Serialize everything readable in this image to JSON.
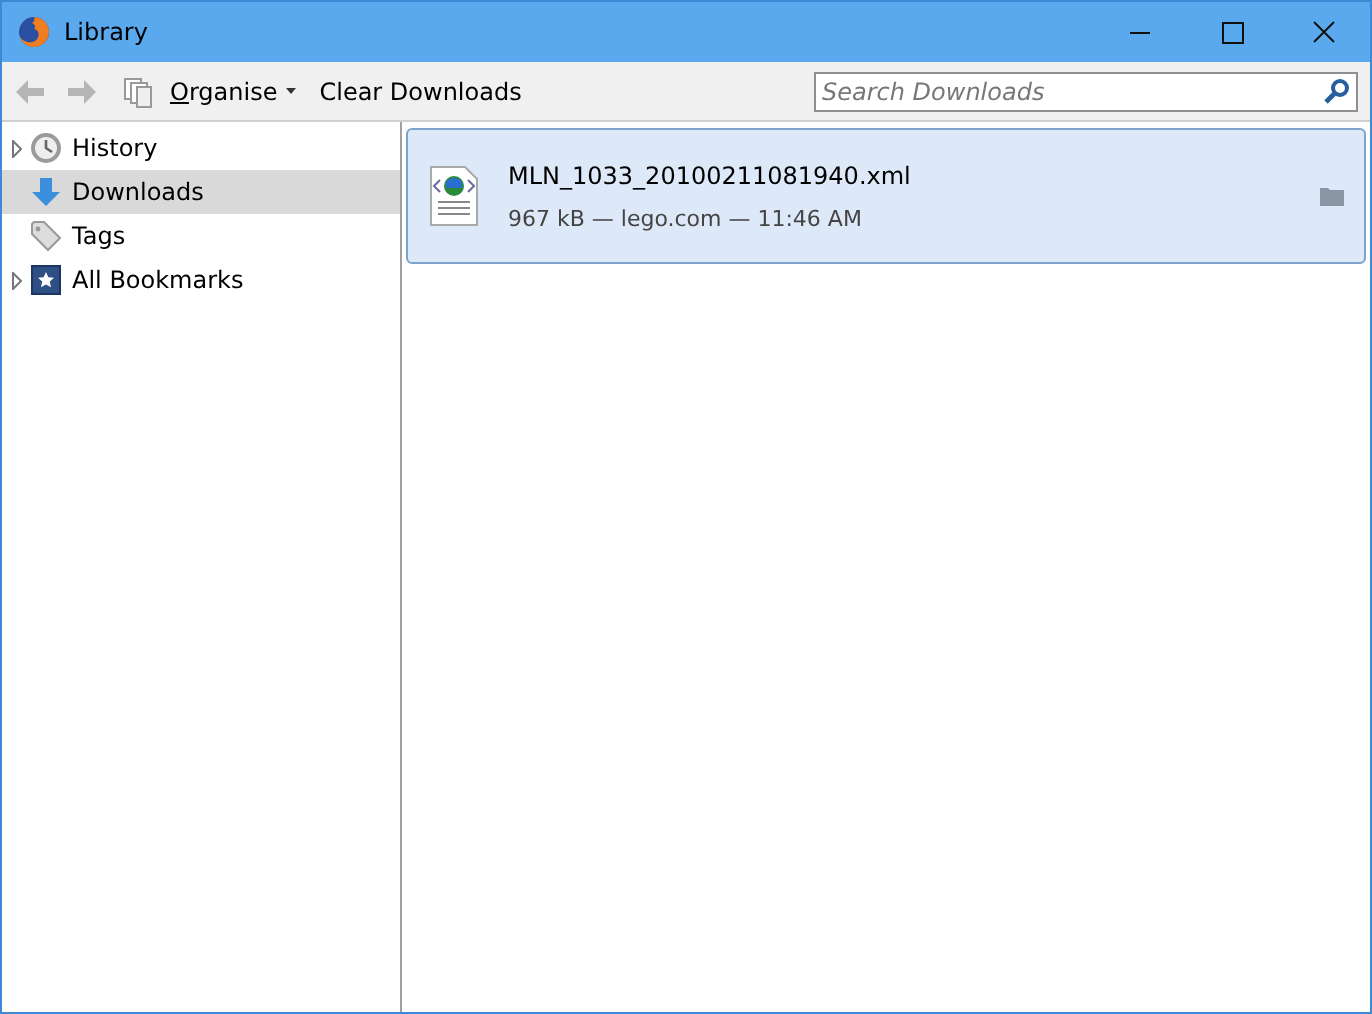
{
  "window": {
    "title": "Library"
  },
  "toolbar": {
    "organise": "Organise",
    "clear": "Clear Downloads",
    "search": {
      "placeholder": "Search Downloads"
    }
  },
  "sidebar": {
    "items": [
      {
        "label": "History",
        "kind": "history",
        "expanded": false,
        "selected": false
      },
      {
        "label": "Downloads",
        "kind": "downloads",
        "selected": true
      },
      {
        "label": "Tags",
        "kind": "tags",
        "selected": false
      },
      {
        "label": "All Bookmarks",
        "kind": "bookmarks",
        "expanded": false,
        "selected": false
      }
    ]
  },
  "downloads": [
    {
      "name": "MLN_1033_20100211081940.xml",
      "details": "967 kB — lego.com — 11:46 AM",
      "selected": true
    }
  ]
}
